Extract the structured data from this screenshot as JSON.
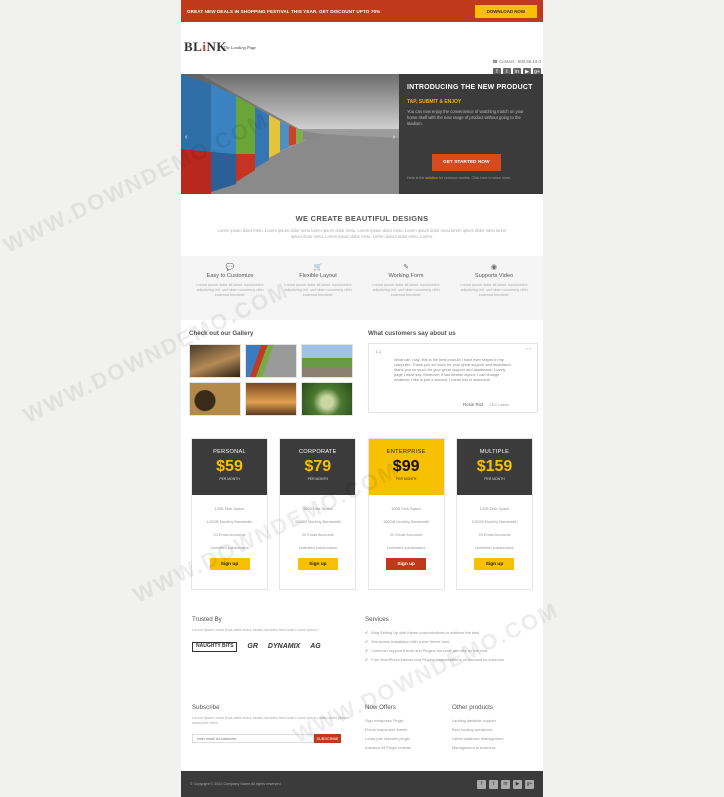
{
  "topbar": {
    "promo_text": "GREAT NEW DEALS IN SHOPPING FESTIVAL THIS YEAR. GET DISCOUNT UPTO 70%",
    "download_label": "DOWNLOAD NOW",
    "bg_color": "#c0391b",
    "button_color": "#f7c000"
  },
  "header": {
    "logo_prefix": "BL",
    "logo_accent": "i",
    "logo_suffix": "NK",
    "tagline": "The Landing Page",
    "contact": "Contact : 600.55.13.0",
    "social_icons": [
      "facebook-icon",
      "twitter-icon",
      "linkedin-icon",
      "youtube-icon",
      "googleplus-icon"
    ]
  },
  "hero": {
    "title": "INTRODUCING THE NEW PRODUCT",
    "subtitle": "TAP, SUBMIT & ENJOY",
    "description": "You can now enjoy the convenience of watching match on your home itself with the new range of product without going to the stadium.",
    "cta_label": "GET STARTED NOW",
    "small_text_prefix": "Hear is the",
    "small_text_highlight": "solution",
    "small_text_suffix": "for common doubts. Click here to know more.",
    "accent_color": "#f2b400"
  },
  "designs": {
    "title": "WE CREATE BEAUTIFUL DESIGNS",
    "text": "Lorem ipsum dolor metu. Lorem ipsum dolor metu lorem ipsum dolor metu. Lorem ipsum dolor metu. Lorem ipsum dolor metu lorem ipsum dolor metu lorem ipsum dolor metu. Lorem ipsum dolor metu. Lorem ipsum dolor metu. Lorem."
  },
  "features": [
    {
      "icon": "chat-icon",
      "title": "Easy to Customize",
      "desc": "Lorem ipsum dolor sit amet, consectetur adipisicing elit, sed diam nonummy nibh euismod tincidunt."
    },
    {
      "icon": "cart-icon",
      "title": "Flexible Layout",
      "desc": "Lorem ipsum dolor sit amet, consectetur adipisicing elit, sed diam nonummy nibh euismod tincidunt."
    },
    {
      "icon": "pencil-icon",
      "title": "Working Form",
      "desc": "Lorem ipsum dolor sit amet, consectetur adipisicing elit, sed diam nonummy nibh euismod tincidunt."
    },
    {
      "icon": "globe-icon",
      "title": "Supports Video",
      "desc": "Lorem ipsum dolor sit amet, consectetur adipisicing elit, sed diam nonummy nibh euismod tincidunt."
    }
  ],
  "gallery": {
    "title": "Check out our Gallery"
  },
  "testimonial": {
    "title": "What customers say about us",
    "quote": "What can I say, this is the best product I have ever stayed in my computer. Thank you so much for your great support and assistance thank you so much for your great support and assistance. Lovely page I must say. Moreover it has flexible layout. I can change whatever I like in just a second. I mean this is awesome.",
    "author": "Rosie Riot",
    "role": "CEO, Leader",
    "nav": "« »"
  },
  "pricing": [
    {
      "name": "PERSONAL",
      "price": "$59",
      "period": "PER MONTH",
      "features": [
        "100B Disk Space",
        "100GB Monthly Bandwidth",
        "20 Email Accounts",
        "Unlimited subdomains"
      ],
      "button": "Sign up",
      "featured": false
    },
    {
      "name": "CORPORATE",
      "price": "$79",
      "period": "PER MONTH",
      "features": [
        "300B Disk Space",
        "300GB Monthly Bandwidth",
        "20 Email Accounts",
        "Unlimited subdomains"
      ],
      "button": "Sign up",
      "featured": false
    },
    {
      "name": "ENTERPRISE",
      "price": "$99",
      "period": "PER MONTH",
      "features": [
        "100B Disk Space",
        "100GB Monthly Bandwidth",
        "20 Email Accounts",
        "Unlimited subdomains"
      ],
      "button": "Sign up",
      "featured": true
    },
    {
      "name": "MULTIPLE",
      "price": "$159",
      "period": "PER MONTH",
      "features": [
        "100B Disk Space",
        "100GB Monthly Bandwidth",
        "20 Email Accounts",
        "Unlimited subdomains"
      ],
      "button": "Sign up",
      "featured": false
    }
  ],
  "trusted": {
    "title": "Trusted By",
    "text": "Lorem ipsum metu that statis dolor sedas sodales fusa sias Lorem ipsum.",
    "brands": [
      "NAUGHTY BITS",
      "GR",
      "DYNAMIX",
      "AG"
    ]
  },
  "services": {
    "title": "Services",
    "items": [
      "Blog Setting Up with theme customizations to address the best",
      "Wordpress Installation with a free theme host",
      "Customer support theme and Plugins via email and site on live chat",
      "Free WordPress themes and Plugins customizations on demand by customer"
    ]
  },
  "subscribe": {
    "title": "Subscribe",
    "text": "Lorem ipsum metu that statis dolor sedas sodales fusa sias Lorem ipsum metu dolor please subscribe here.",
    "placeholder": "enter email for subscribe",
    "button": "SUBSCRIBE"
  },
  "offers": {
    "title": "Now Offers",
    "items": [
      "Sign wordpress Plugin",
      "Finest responsive theme",
      "Looks just between plugin",
      "Advance All Plugin ontents"
    ]
  },
  "others": {
    "title": "Other products",
    "items": [
      "Landing landable support",
      "Best hosting wordpress",
      "Latest database management",
      "Management to business"
    ]
  },
  "footer": {
    "copyright": "© Copyright © 2013 Company Name All rights reserved",
    "social_icons": [
      "facebook-icon",
      "twitter-icon",
      "linkedin-icon",
      "youtube-icon",
      "googleplus-icon"
    ]
  },
  "watermark": "WWW.DOWNDEMO.COM"
}
